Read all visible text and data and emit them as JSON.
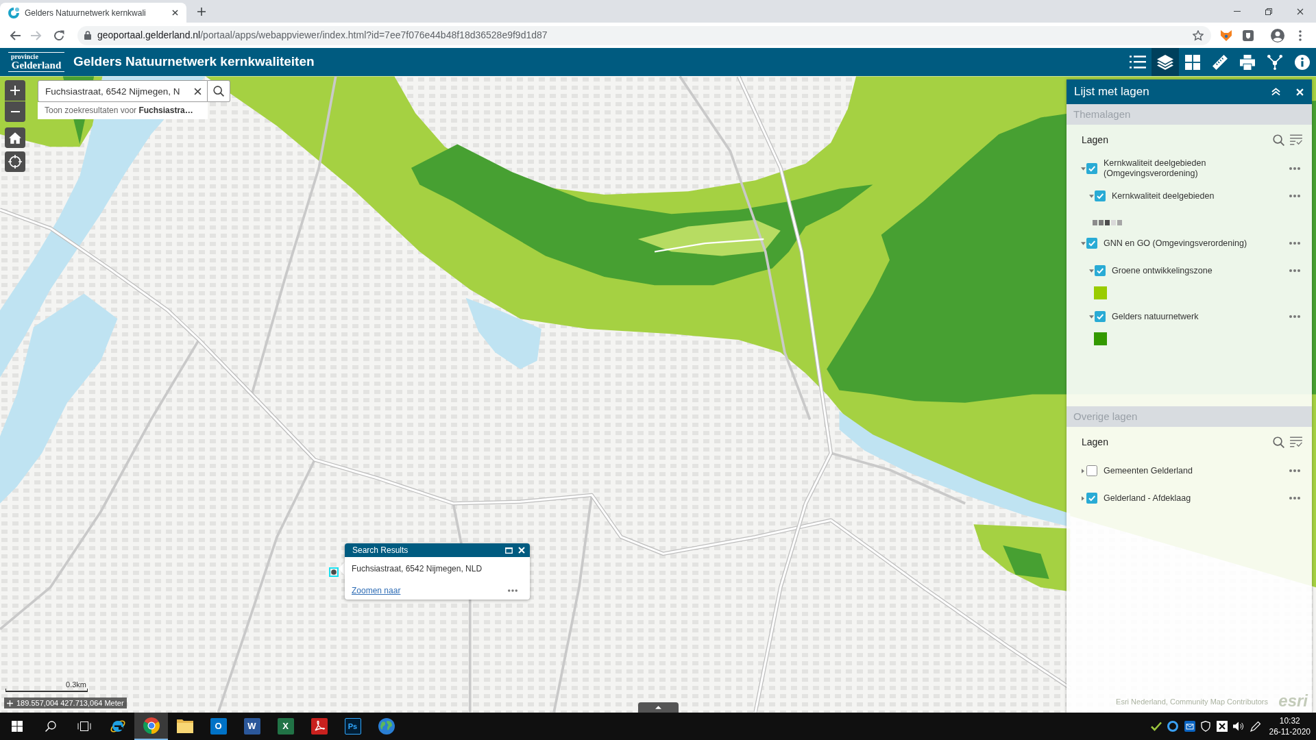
{
  "browser": {
    "tab": {
      "title": "Gelders Natuurnetwerk kernkwali"
    },
    "url": {
      "domain": "geoportaal.gelderland.nl",
      "path": "/portaal/apps/webappviewer/index.html?id=7ee7f076e44b48f18d36528e9f9d1d87"
    }
  },
  "header": {
    "logo": {
      "top": "provincie",
      "bottom": "Gelderland"
    },
    "title": "Gelders Natuurnetwerk kernkwaliteiten",
    "tools": [
      {
        "kind": "list",
        "selected": false
      },
      {
        "kind": "layers",
        "selected": true
      },
      {
        "kind": "grid",
        "selected": false
      },
      {
        "kind": "ruler",
        "selected": false
      },
      {
        "kind": "print",
        "selected": false
      },
      {
        "kind": "network",
        "selected": false
      },
      {
        "kind": "info",
        "selected": false
      }
    ]
  },
  "search": {
    "value": "Fuchsiastraat, 6542 Nijmegen, N",
    "suggestion": "Toon zoekresultaten voor **Fuchsiastra…**"
  },
  "layer_panel": {
    "title": "Lijst met lagen",
    "sections": [
      {
        "title": "Themalagen",
        "heading": "Lagen",
        "layers": [
          {
            "label": "Kernkwaliteit deelgebieden (Omgevingsverordening)",
            "checked": true,
            "expanded": true,
            "children": [
              {
                "label": "Kernkwaliteit deelgebieden",
                "checked": true,
                "expanded": true,
                "legend": [
                  {
                    "color": "#8c8c8c"
                  },
                  {
                    "color": "#7a7a7a"
                  },
                  {
                    "color": "#4d4d4d"
                  },
                  {
                    "color": "#d9d9d9"
                  },
                  {
                    "color": "#a6a6a6"
                  }
                ]
              }
            ]
          },
          {
            "label": "GNN en GO (Omgevingsverordening)",
            "checked": true,
            "expanded": true,
            "children": [
              {
                "label": "Groene ontwikkelingszone",
                "checked": true,
                "expanded": true,
                "legend": [
                  {
                    "color": "#99cc00"
                  }
                ]
              },
              {
                "label": "Gelders natuurnetwerk",
                "checked": true,
                "expanded": true,
                "legend": [
                  {
                    "color": "#339900"
                  }
                ]
              }
            ]
          }
        ]
      },
      {
        "title": "Overige lagen",
        "heading": "Lagen",
        "layers": [
          {
            "label": "Gemeenten Gelderland",
            "checked": false,
            "expanded": false
          },
          {
            "label": "Gelderland - Afdeklaag",
            "checked": true,
            "expanded": false
          }
        ]
      }
    ]
  },
  "search_results": {
    "title": "Search Results",
    "address": "Fuchsiastraat, 6542 Nijmegen, NLD",
    "link": "Zoomen naar"
  },
  "map": {
    "scale": "0.3km",
    "coordinates": "189.557,004 427.713,064 Meter",
    "attribution": "Esri Nederland, Community Map Contributors",
    "logo": "esri"
  },
  "taskbar": {
    "apps": [
      {
        "kind": "start",
        "selected": false
      },
      {
        "kind": "search",
        "selected": false
      },
      {
        "kind": "task_view",
        "selected": false
      },
      {
        "kind": "e_browser",
        "selected": false
      },
      {
        "kind": "circle_browser",
        "selected": true
      },
      {
        "kind": "folder",
        "selected": false
      },
      {
        "kind": "mail_tile",
        "glyph": "O",
        "selected": false
      },
      {
        "kind": "doc_tile",
        "glyph": "W",
        "selected": false
      },
      {
        "kind": "sheet_tile",
        "glyph": "X",
        "selected": false
      },
      {
        "kind": "pdf_tile",
        "selected": false
      },
      {
        "kind": "image_tile",
        "glyph": "Ps",
        "selected": false
      },
      {
        "kind": "globe",
        "selected": false
      }
    ],
    "time": "10:32",
    "date": "26-11-2020"
  }
}
